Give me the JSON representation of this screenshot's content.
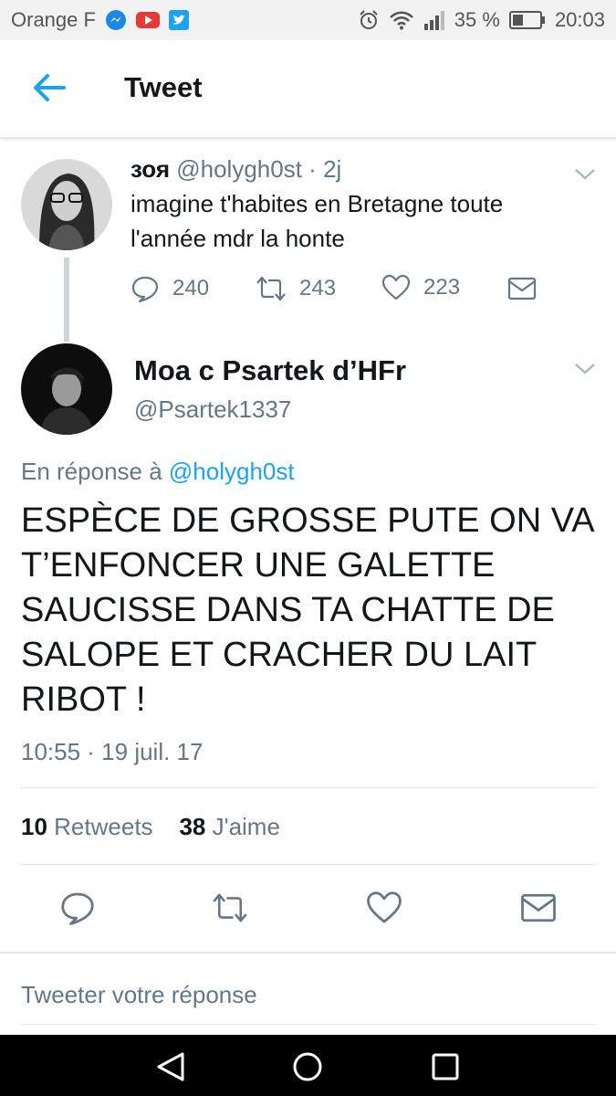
{
  "status_bar": {
    "carrier": "Orange F",
    "battery": "35 %",
    "time": "20:03",
    "notification_icons": [
      "messenger-icon",
      "youtube-icon",
      "twitter-icon"
    ],
    "system_icons": [
      "alarm-icon",
      "wifi-icon",
      "signal-icon",
      "battery-icon"
    ]
  },
  "header": {
    "title": "Tweet"
  },
  "parent_tweet": {
    "name": "зоя",
    "handle": "@holygh0st",
    "separator": "·",
    "age": "2j",
    "text": "imagine t'habites en Bretagne toute l'année mdr la honte",
    "replies": "240",
    "retweets": "243",
    "likes": "223"
  },
  "main_tweet": {
    "name": "Moa c Psartek d’HFr",
    "handle": "@Psartek1337",
    "reply_prefix": "En réponse à",
    "reply_to": "@holygh0st",
    "text": "ESPÈCE DE GROSSE PUTE ON VA T’ENFONCER UNE GALETTE SAUCISSE DANS TA CHATTE DE SALOPE ET CRACHER DU LAIT RIBOT !",
    "timestamp": "10:55 · 19 juil. 17",
    "retweet_count": "10",
    "retweet_label": "Retweets",
    "like_count": "38",
    "like_label": "J'aime"
  },
  "reply_box": {
    "placeholder": "Tweeter votre réponse"
  },
  "colors": {
    "accent": "#1da1f2",
    "secondary_text": "#657786",
    "divider": "#e1e8ed"
  }
}
